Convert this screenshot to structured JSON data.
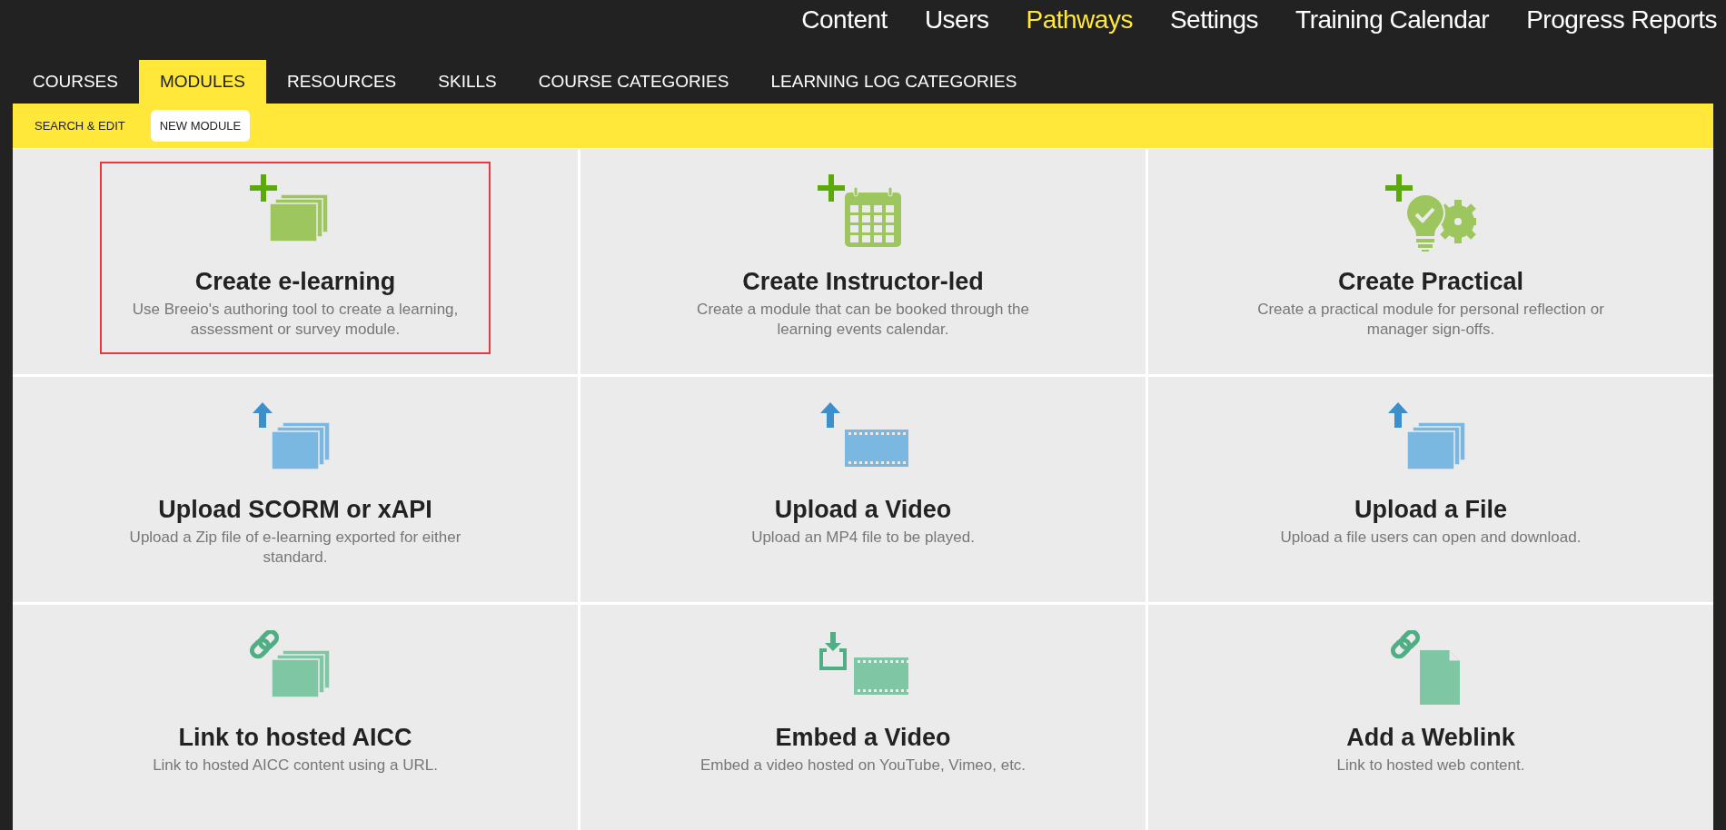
{
  "top_nav": [
    {
      "label": "Content",
      "selected": false
    },
    {
      "label": "Users",
      "selected": false
    },
    {
      "label": "Pathways",
      "selected": true
    },
    {
      "label": "Settings",
      "selected": false
    },
    {
      "label": "Training Calendar",
      "selected": false
    },
    {
      "label": "Progress Reports",
      "selected": false
    }
  ],
  "tabs": [
    {
      "label": "COURSES",
      "selected": false
    },
    {
      "label": "MODULES",
      "selected": true
    },
    {
      "label": "RESOURCES",
      "selected": false
    },
    {
      "label": "SKILLS",
      "selected": false
    },
    {
      "label": "COURSE CATEGORIES",
      "selected": false
    },
    {
      "label": "LEARNING LOG CATEGORIES",
      "selected": false
    }
  ],
  "sub_tabs": [
    {
      "label": "SEARCH & EDIT",
      "selected": false
    },
    {
      "label": "NEW MODULE",
      "selected": true
    }
  ],
  "cards": [
    {
      "kind": "elearning",
      "title": "Create e-learning",
      "description": "Use Breeio's authoring tool to create a learning, assessment or survey module.",
      "selected": true
    },
    {
      "kind": "instructor",
      "title": "Create Instructor-led",
      "description": "Create a module that can be booked through the learning events calendar.",
      "selected": false
    },
    {
      "kind": "practical",
      "title": "Create Practical",
      "description": "Create a practical module for personal reflection or manager sign-offs.",
      "selected": false
    },
    {
      "kind": "scorm",
      "title": "Upload SCORM or xAPI",
      "description": "Upload a Zip file of e-learning exported for either standard.",
      "selected": false
    },
    {
      "kind": "video",
      "title": "Upload a Video",
      "description": "Upload an MP4 file to be played.",
      "selected": false
    },
    {
      "kind": "file",
      "title": "Upload a File",
      "description": "Upload a file users can open and download.",
      "selected": false
    },
    {
      "kind": "aicc",
      "title": "Link to hosted AICC",
      "description": "Link to hosted AICC content using a URL.",
      "selected": false
    },
    {
      "kind": "embed",
      "title": "Embed a Video",
      "description": "Embed a video hosted on YouTube, Vimeo, etc.",
      "selected": false
    },
    {
      "kind": "weblink",
      "title": "Add a Weblink",
      "description": "Link to hosted web content.",
      "selected": false
    }
  ]
}
